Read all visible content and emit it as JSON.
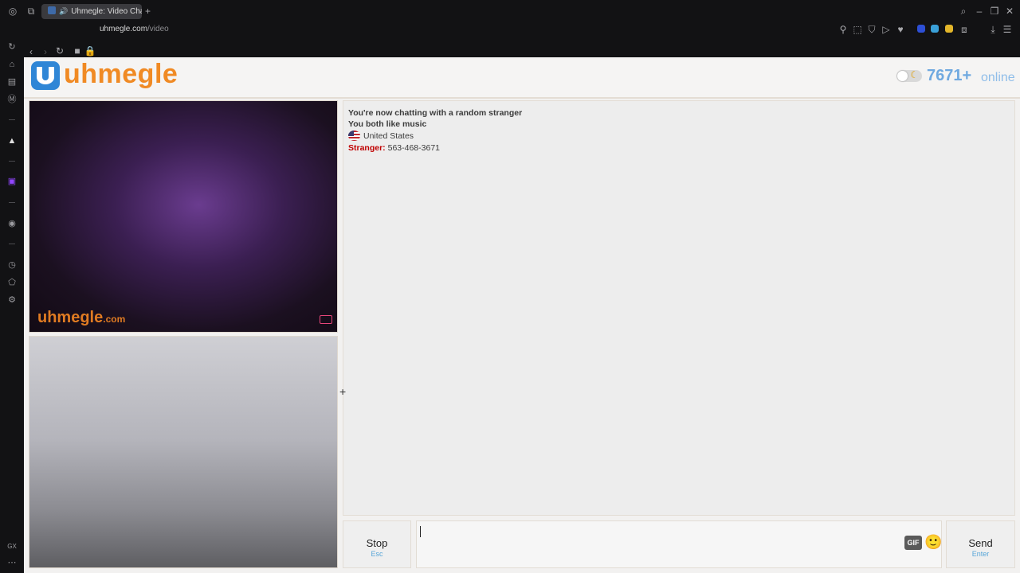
{
  "browser": {
    "tab_title": "Uhmegle: Video Chat",
    "new_tab_symbol": "+",
    "url_host": "uhmegle.com",
    "url_path": "/video"
  },
  "site": {
    "logo_text": "uhmegle",
    "online_count": "7671+",
    "online_label": "online"
  },
  "video": {
    "watermark_main": "uhmegle",
    "watermark_suffix": ".com"
  },
  "chat": {
    "messages": [
      {
        "text": "You're now chatting with a random stranger"
      },
      {
        "text": "You both like music"
      },
      {
        "text": "United States"
      }
    ],
    "stranger_label": "Stranger:",
    "stranger_message": "563-468-3671"
  },
  "controls": {
    "stop_label": "Stop",
    "stop_hint": "Esc",
    "send_label": "Send",
    "send_hint": "Enter",
    "gif_label": "GIF",
    "emoji": "🙂"
  },
  "colors": {
    "brand_orange": "#f08a24",
    "online_blue": "#70a9e0",
    "stranger_red": "#c00000",
    "hint_blue": "#58a6d8"
  }
}
